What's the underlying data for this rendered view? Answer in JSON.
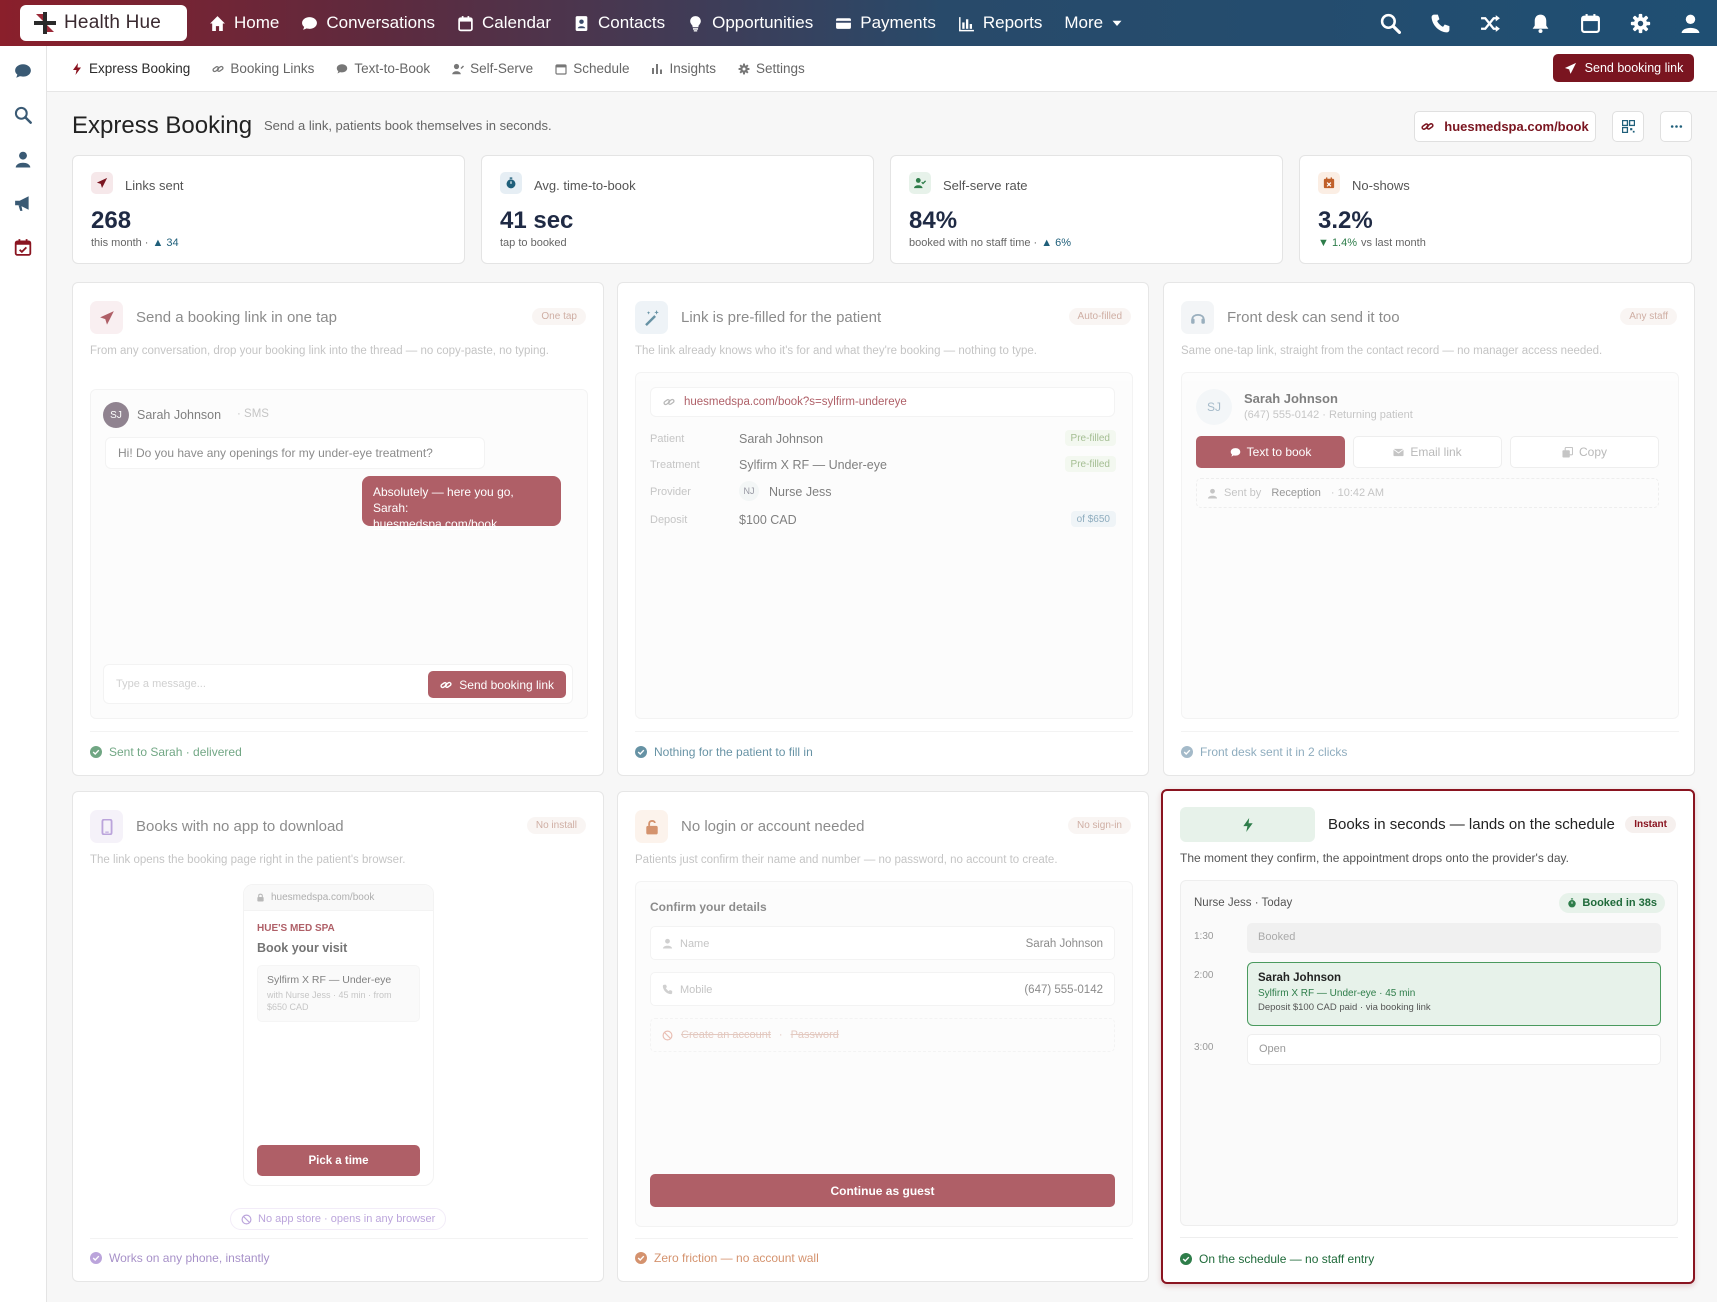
{
  "app": {
    "name": "Health Hue"
  },
  "topnav": {
    "items": [
      {
        "label": "Home",
        "icon": "home-icon"
      },
      {
        "label": "Conversations",
        "icon": "chat-icon"
      },
      {
        "label": "Calendar",
        "icon": "calendar-icon"
      },
      {
        "label": "Contacts",
        "icon": "contacts-icon"
      },
      {
        "label": "Opportunities",
        "icon": "lightbulb-icon"
      },
      {
        "label": "Payments",
        "icon": "credit-card-icon"
      },
      {
        "label": "Reports",
        "icon": "bar-chart-icon"
      },
      {
        "label": "More",
        "icon": "chevron-down-icon"
      }
    ],
    "right_icons": [
      "search-icon",
      "phone-icon",
      "shuffle-icon",
      "bell-icon",
      "calendar-icon",
      "gear-icon",
      "user-icon"
    ]
  },
  "sidebar": {
    "icons": [
      "chat-icon",
      "search-icon",
      "user-icon",
      "megaphone-icon",
      "calendar-check-icon"
    ]
  },
  "subnav": {
    "tabs": [
      {
        "label": "Express Booking",
        "icon": "lightning-icon",
        "active": true
      },
      {
        "label": "Booking Links",
        "icon": "link-icon"
      },
      {
        "label": "Text-to-Book",
        "icon": "chat-icon"
      },
      {
        "label": "Self-Serve",
        "icon": "user-edit-icon"
      },
      {
        "label": "Schedule",
        "icon": "calendar-icon"
      },
      {
        "label": "Insights",
        "icon": "bar-chart-icon"
      },
      {
        "label": "Settings",
        "icon": "gear-icon"
      }
    ],
    "send_button": "Send booking link"
  },
  "page": {
    "title": "Express Booking",
    "subtitle": "Send a link, patients book themselves in seconds.",
    "url_button": "huesmedspa.com/book"
  },
  "stats": [
    {
      "label": "Links sent",
      "value": "268",
      "foot": "this month ·",
      "delta": "▲ 34",
      "icon": "send-icon",
      "accent": "#7a1520"
    },
    {
      "label": "Avg. time-to-book",
      "value": "41 sec",
      "foot": "tap to booked",
      "delta": "",
      "icon": "stopwatch-icon",
      "accent": "#1f5f7a"
    },
    {
      "label": "Self-serve rate",
      "value": "84%",
      "foot": "booked with no staff time ·",
      "delta": "▲ 6%",
      "icon": "user-check-icon",
      "accent": "#2e7d4a"
    },
    {
      "label": "No-shows",
      "value": "3.2%",
      "foot": "vs last month",
      "delta": "▼ 1.4%",
      "icon": "calendar-x-icon",
      "accent": "#c0602a"
    }
  ],
  "cards": {
    "one_tap": {
      "title": "Send a booking link in one tap",
      "badge": "One tap",
      "desc": "From any conversation, drop your booking link into the thread — no copy-paste, no typing.",
      "contact_initials": "SJ",
      "contact_name": "Sarah Johnson",
      "channel": "· SMS",
      "incoming": "Hi! Do you have any openings for my under-eye treatment?",
      "reply": "Absolutely — here you go, Sarah:",
      "reply_link": "huesmedspa.com/book",
      "composer_placeholder": "Type a message...",
      "composer_button": "Send booking link",
      "footer": "Sent to Sarah · delivered"
    },
    "prefilled": {
      "title": "Link is pre-filled for the patient",
      "badge": "Auto-filled",
      "desc": "The link already knows who it's for and what they're booking — nothing to type.",
      "url": "huesmedspa.com/book?s=sylfirm-undereye",
      "rows": [
        {
          "label": "Patient",
          "value": "Sarah Johnson",
          "tag": "Pre-filled"
        },
        {
          "label": "Treatment",
          "value": "Sylfirm X RF — Under-eye",
          "tag": "Pre-filled"
        },
        {
          "label": "Provider",
          "value": "Nurse Jess",
          "initials": "NJ",
          "tag": ""
        },
        {
          "label": "Deposit",
          "value": "$100 CAD",
          "tag": "of $650"
        }
      ],
      "footer": "Nothing for the patient to fill in"
    },
    "front_desk": {
      "title": "Front desk can send it too",
      "badge": "Any staff",
      "desc": "Same one-tap link, straight from the contact record — no manager access needed.",
      "contact_initials": "SJ",
      "contact_name": "Sarah Johnson",
      "contact_meta": "(647) 555-0142 · Returning patient",
      "actions": [
        "Text to book",
        "Email link",
        "Copy"
      ],
      "sent_by_label": "Sent by",
      "sent_by": "Reception",
      "sent_time": "· 10:42 AM",
      "footer": "Front desk sent it in 2 clicks"
    },
    "no_app": {
      "title": "Books with no app to download",
      "badge": "No install",
      "desc": "The link opens the booking page right in the patient's browser.",
      "url": "huesmedspa.com/book",
      "brand": "HUE'S MED SPA",
      "heading": "Book your visit",
      "service": "Sylfirm X RF — Under-eye",
      "service_meta": "with Nurse Jess · 45 min · from $650 CAD",
      "cta": "Pick a time",
      "note": "No app store · opens in any browser",
      "footer": "Works on any phone, instantly"
    },
    "no_login": {
      "title": "No login or account needed",
      "badge": "No sign-in",
      "desc": "Patients just confirm their name and number — no password, no account to create.",
      "form_title": "Confirm your details",
      "fields": [
        {
          "label": "Name",
          "value": "Sarah Johnson"
        },
        {
          "label": "Mobile",
          "value": "(647) 555-0142"
        }
      ],
      "struck": "Create an account",
      "struck2": "Password",
      "cta": "Continue as guest",
      "footer": "Zero friction — no account wall"
    },
    "schedule": {
      "title": "Books in seconds — lands on the schedule",
      "badge": "Instant",
      "desc": "The moment they confirm, the appointment drops onto the provider's day.",
      "header": "Nurse Jess · Today",
      "booked_badge": "Booked in 38s",
      "slots": [
        {
          "time": "1:30",
          "label": "Booked"
        },
        {
          "time": "2:00",
          "name": "Sarah Johnson",
          "detail": "Sylfirm X RF — Under-eye · 45 min",
          "meta": "Deposit $100 CAD paid · via booking link"
        },
        {
          "time": "3:00",
          "label": "Open"
        }
      ],
      "footer": "On the schedule — no staff entry"
    }
  },
  "colors": {
    "brand": "#7a1520",
    "rose": "#b27c82",
    "teal": "#1f5f7a",
    "green": "#2e7d4a",
    "orange": "#c0602a",
    "purple": "#9b7acb"
  }
}
